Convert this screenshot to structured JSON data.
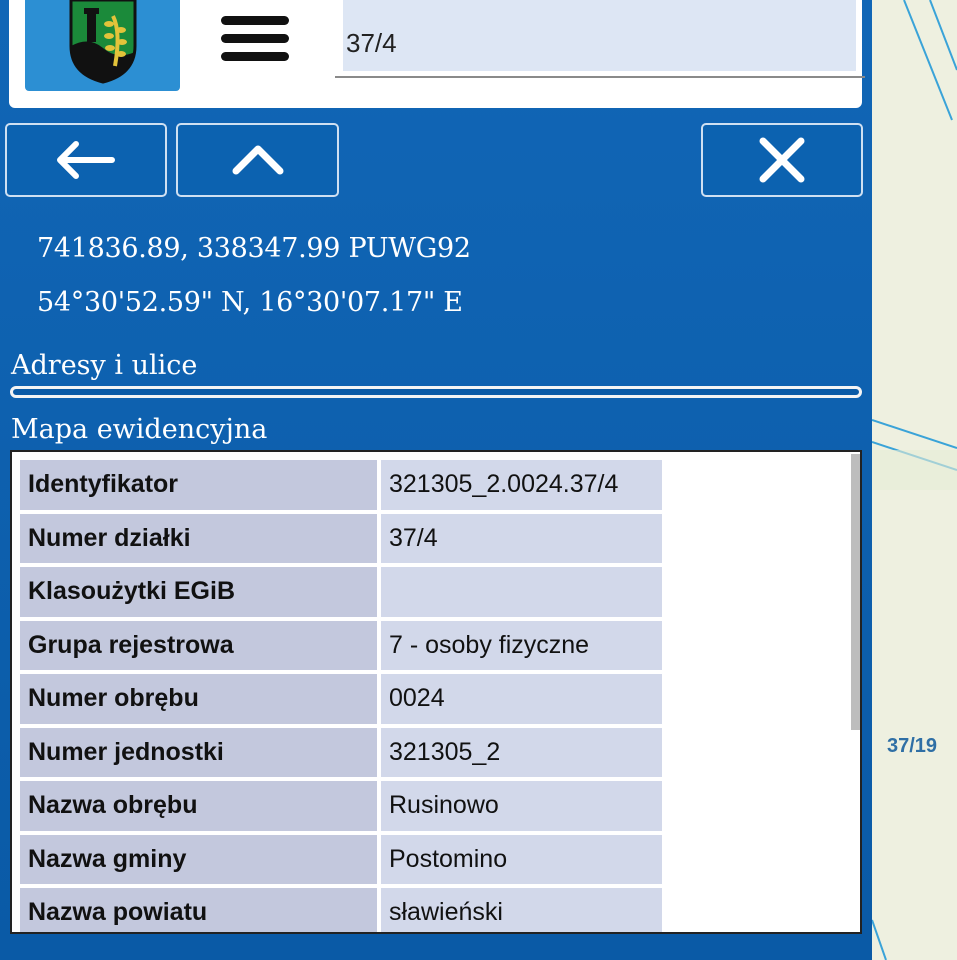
{
  "header": {
    "search_value": "37/4",
    "logo_icon": "coat-of-arms-icon",
    "menu_icon": "hamburger-icon"
  },
  "nav": {
    "back_icon": "arrow-left-icon",
    "up_icon": "chevron-up-icon",
    "close_icon": "close-icon"
  },
  "coords": {
    "puwg": "741836.89, 338347.99 PUWG92",
    "geo": "54°30'52.59\" N, 16°30'07.17\" E"
  },
  "sections": {
    "adresy": "Adresy i ulice",
    "mapa": "Mapa ewidencyjna"
  },
  "table": {
    "rows": [
      {
        "key": "Identyfikator",
        "value": "321305_2.0024.37/4"
      },
      {
        "key": "Numer działki",
        "value": "37/4"
      },
      {
        "key": "Klasoużytki EGiB",
        "value": ""
      },
      {
        "key": "Grupa rejestrowa",
        "value": "7 - osoby fizyczne"
      },
      {
        "key": "Numer obrębu",
        "value": "0024"
      },
      {
        "key": "Numer jednostki",
        "value": "321305_2"
      },
      {
        "key": "Nazwa obrębu",
        "value": "Rusinowo"
      },
      {
        "key": "Nazwa gminy",
        "value": "Postomino"
      },
      {
        "key": "Nazwa powiatu",
        "value": "sławieński"
      }
    ]
  },
  "map": {
    "parcel_label": "37/19"
  },
  "colors": {
    "panel": "#0a5da8",
    "logo_bg": "#2c8fd3",
    "map_bg": "#eef0e0",
    "parcel_line": "#3aa3d8"
  }
}
